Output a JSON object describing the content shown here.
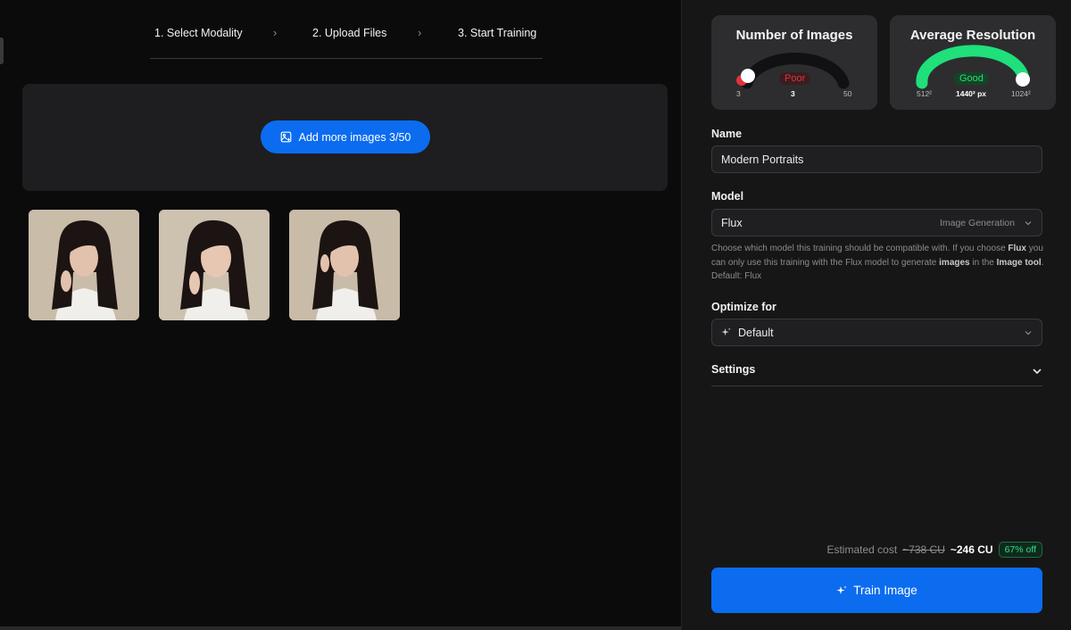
{
  "steps": [
    {
      "label": "1. Select Modality"
    },
    {
      "label": "2. Upload Files"
    },
    {
      "label": "3. Start Training"
    }
  ],
  "step_separator": "›",
  "upload": {
    "add_button_label": "Add more images 3/50",
    "add_button_icon": "image-add-icon",
    "thumbnails": [
      {
        "alt": "portrait-1"
      },
      {
        "alt": "portrait-2"
      },
      {
        "alt": "portrait-3"
      }
    ]
  },
  "stats": {
    "images": {
      "title": "Number of Images",
      "status": "Poor",
      "status_color": "#e0333d",
      "min": "3",
      "max": "50",
      "value": "3",
      "fill_fraction": 0.0
    },
    "resolution": {
      "title": "Average Resolution",
      "status": "Good",
      "status_color": "#22e07a",
      "min": "512²",
      "max": "1024²",
      "value": "1440² px",
      "fill_fraction": 1.0
    }
  },
  "form": {
    "name_label": "Name",
    "name_value": "Modern Portraits",
    "model_label": "Model",
    "model_value": "Flux",
    "model_sub": "Image Generation",
    "help_parts": [
      "Choose which model this training should be compatible with. If you choose ",
      "Flux",
      " you can only use this training with the Flux model to generate ",
      "images",
      " in the ",
      "Image tool",
      ". Default: Flux"
    ],
    "optimize_label": "Optimize for",
    "optimize_value": "Default",
    "settings_label": "Settings"
  },
  "cost": {
    "label": "Estimated cost",
    "old": "~738 CU",
    "new": "~246 CU",
    "discount": "67% off"
  },
  "train_button_label": "Train Image",
  "colors": {
    "accent": "#0b6cf0",
    "panel": "#161617",
    "card": "#2d2d2f"
  }
}
